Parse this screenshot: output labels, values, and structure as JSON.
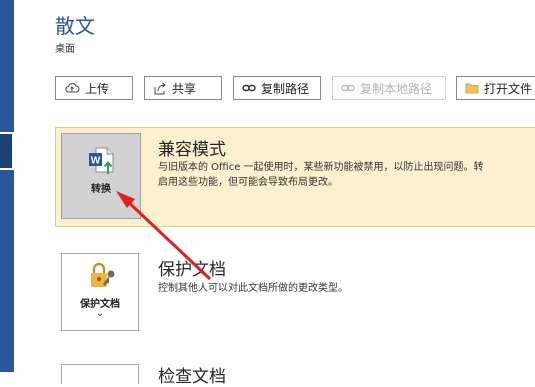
{
  "header": {
    "title": "散文",
    "location": "桌面"
  },
  "toolbar": {
    "upload": "上传",
    "share": "共享",
    "copy_path": "复制路径",
    "copy_local_path": "复制本地路径",
    "open_file": "打开文件"
  },
  "compat": {
    "title": "兼容模式",
    "desc_line1": "与旧版本的 Office 一起使用时，某些新功能被禁用，以防止出现问题。转",
    "desc_line2": "启用这些功能，但可能会导致布局更改。",
    "button_label": "转换"
  },
  "protect": {
    "title": "保护文档",
    "desc": "控制其他人可以对此文档所做的更改类型。",
    "button_label": "保护文档",
    "caret": "⌄"
  },
  "inspect": {
    "title": "检查文档"
  },
  "colors": {
    "accent": "#2b579a",
    "annotation_arrow": "#e02020",
    "compat_bg": "#fdf0cf"
  }
}
